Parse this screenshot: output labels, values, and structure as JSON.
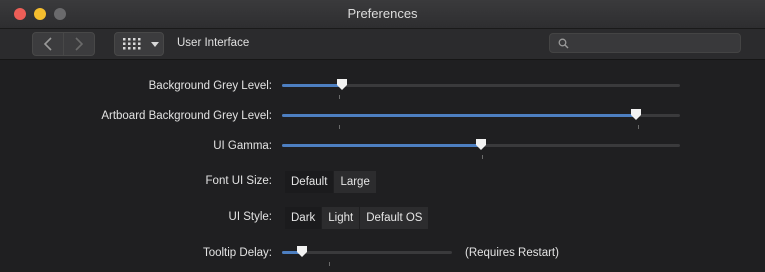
{
  "window": {
    "title": "Preferences"
  },
  "toolbar": {
    "back_icon": "chevron-left-icon",
    "forward_icon": "chevron-right-icon",
    "grid_icon": "grid-icon",
    "section": "User Interface",
    "search": {
      "placeholder": "",
      "value": ""
    }
  },
  "settings": {
    "background_grey": {
      "label": "Background Grey Level:",
      "value": 0.15
    },
    "artboard_grey": {
      "label": "Artboard Background Grey Level:",
      "value": 0.89
    },
    "ui_gamma": {
      "label": "UI Gamma:",
      "value": 0.5
    },
    "font_ui_size": {
      "label": "Font UI Size:",
      "options": [
        "Default",
        "Large"
      ],
      "selected": "Default"
    },
    "ui_style": {
      "label": "UI Style:",
      "options": [
        "Dark",
        "Light",
        "Default OS"
      ],
      "selected": "Dark"
    },
    "tooltip_delay": {
      "label": "Tooltip Delay:",
      "value": 0.12,
      "note": "(Requires Restart)"
    }
  },
  "colors": {
    "accent": "#4d7fc1",
    "background": "#1f1f21"
  }
}
